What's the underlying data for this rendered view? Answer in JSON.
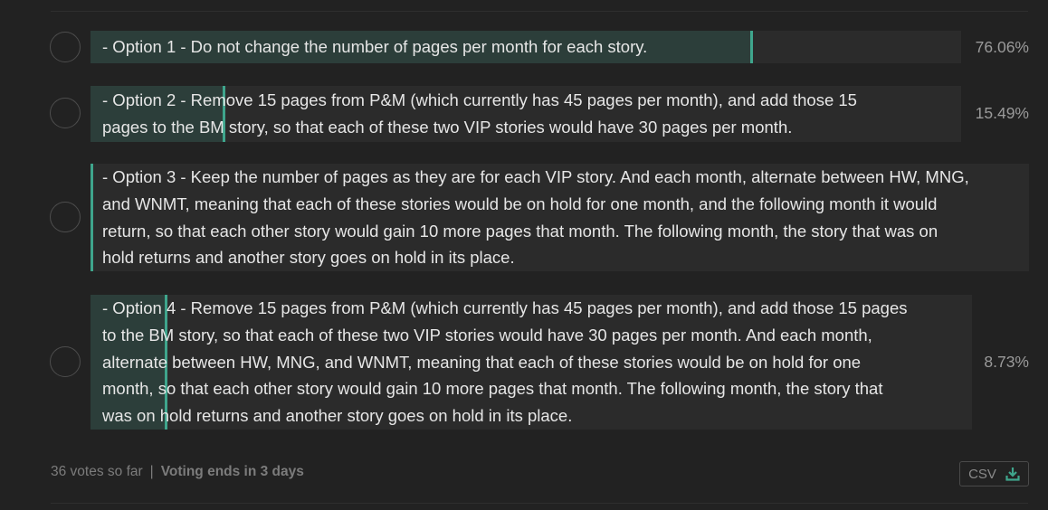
{
  "poll": {
    "options": [
      {
        "lines": [
          "- Option 1 - Do not change the number of pages per month for each story."
        ],
        "percent_label": "76.06%",
        "percent": 76.06
      },
      {
        "lines": [
          "- Option 2 - Remove 15 pages from P&M (which currently has 45 pages per month), and add those 15",
          "pages to the BM story, so that each of these two VIP stories would have 30 pages per month."
        ],
        "percent_label": "15.49%",
        "percent": 15.49
      },
      {
        "lines": [
          "- Option 3 - Keep the number of pages as they are for each VIP story. And each month, alternate between HW, MNG,",
          "and WNMT, meaning that each of these stories would be on hold for one month, and the following month it would",
          "return, so that each other story would gain 10 more pages that month. The following month, the story that was on",
          "hold returns and another story goes on hold in its place."
        ],
        "percent_label": "",
        "percent": 0
      },
      {
        "lines": [
          "- Option 4 - Remove 15 pages from P&M (which currently has 45 pages per month), and add those 15 pages",
          "to the BM story, so that each of these two VIP stories would have 30 pages per month. And each month,",
          "alternate between HW, MNG, and WNMT, meaning that each of these stories would be on hold for one",
          "month, so that each other story would gain 10 more pages that month. The following month, the story that",
          "was on hold returns and another story goes on hold in its place."
        ],
        "percent_label": "8.73%",
        "percent": 8.73
      }
    ]
  },
  "footer": {
    "votes": "36 votes so far",
    "separator": "|",
    "ends": "Voting ends in 3 days"
  },
  "csv_button": {
    "label": "CSV",
    "icon": "download-icon"
  },
  "colors": {
    "accent": "#3fa58c",
    "fill": "#2c3e3a",
    "option_bg": "#2b2b2b",
    "background": "#222222"
  }
}
